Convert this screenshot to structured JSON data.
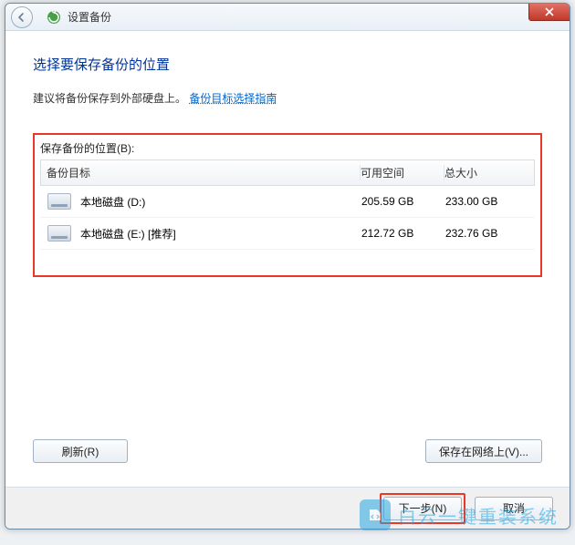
{
  "titlebar": {
    "title": "设置备份"
  },
  "heading": "选择要保存备份的位置",
  "advice": "建议将备份保存到外部硬盘上。",
  "link": "备份目标选择指南",
  "list_label": "保存备份的位置(B):",
  "columns": {
    "target": "备份目标",
    "free": "可用空间",
    "total": "总大小"
  },
  "drives": [
    {
      "name": "本地磁盘 (D:)",
      "free": "205.59 GB",
      "total": "233.00 GB"
    },
    {
      "name": "本地磁盘 (E:) [推荐]",
      "free": "212.72 GB",
      "total": "232.76 GB"
    }
  ],
  "buttons": {
    "refresh": "刷新(R)",
    "save_net": "保存在网络上(V)...",
    "next": "下一步(N)",
    "cancel": "取消"
  },
  "watermark": "白云一键重装系统"
}
